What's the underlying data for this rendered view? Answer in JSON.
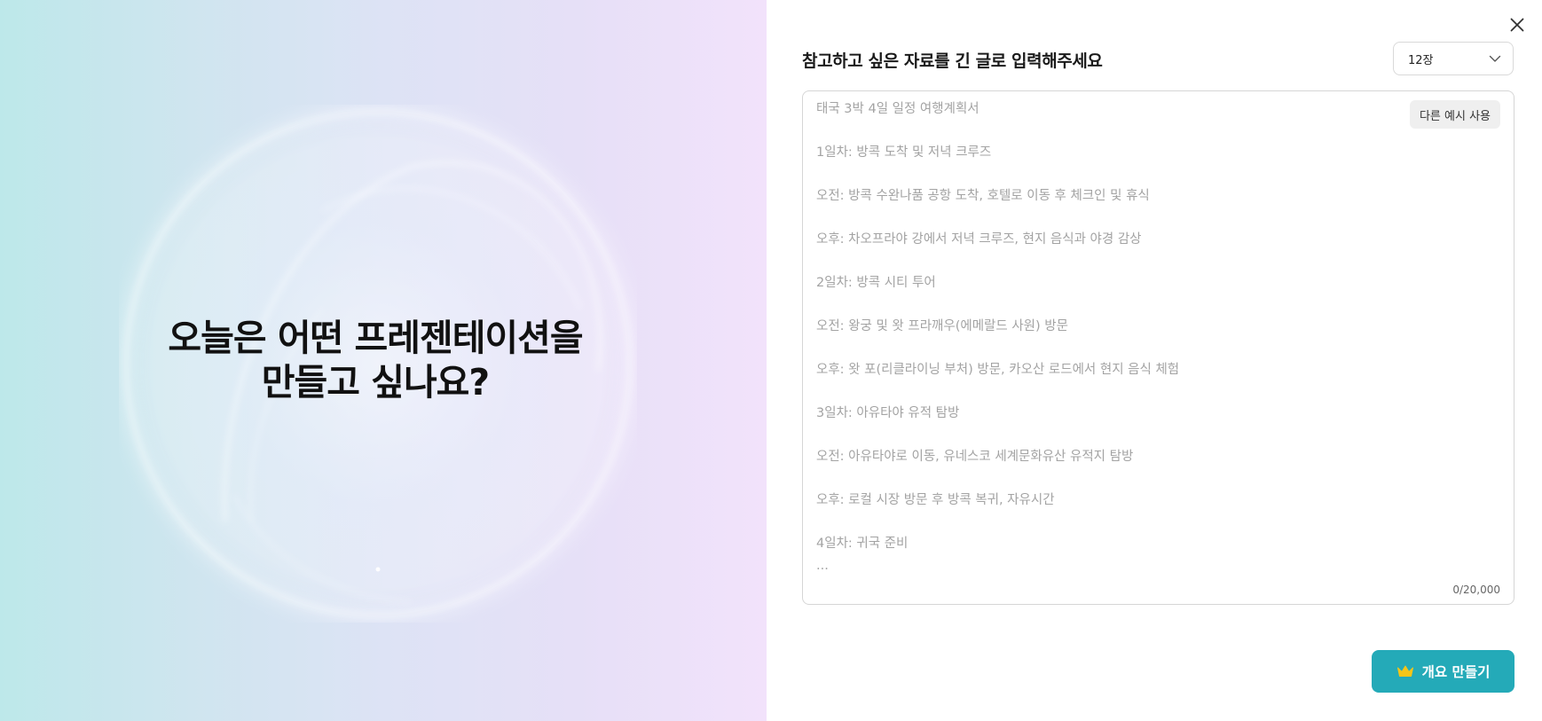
{
  "hero": {
    "title_line1": "오늘은 어떤 프레젠테이션을",
    "title_line2": "만들고 싶나요?"
  },
  "form": {
    "title": "참고하고 싶은 자료를 긴 글로 입력해주세요",
    "slide_count": "12장",
    "placeholder": "태국 3박 4일 일정 여행계획서\n\n1일차: 방콕 도착 및 저녁 크루즈\n\n오전: 방콕 수완나품 공항 도착, 호텔로 이동 후 체크인 및 휴식\n\n오후: 차오프라야 강에서 저녁 크루즈, 현지 음식과 야경 감상\n\n2일차: 방콕 시티 투어\n\n오전: 왕궁 및 왓 프라깨우(에메랄드 사원) 방문\n\n오후: 왓 포(리클라이닝 부처) 방문, 카오산 로드에서 현지 음식 체험\n\n3일차: 아유타야 유적 탐방\n\n오전: 아유타야로 이동, 유네스코 세계문화유산 유적지 탐방\n\n오후: 로컬 시장 방문 후 방콕 복귀, 자유시간\n\n4일차: 귀국 준비\n...",
    "example_button": "다른 예시 사용",
    "char_counter": "0/20,000",
    "submit_label": "개요 만들기"
  },
  "icons": {
    "close": "close-icon",
    "chevron": "chevron-down-icon",
    "crown": "crown-icon"
  },
  "colors": {
    "accent": "#24aab8",
    "crown": "#f5c518",
    "hero_gradient_start": "#bde8ea",
    "hero_gradient_end": "#f2e2fb"
  }
}
